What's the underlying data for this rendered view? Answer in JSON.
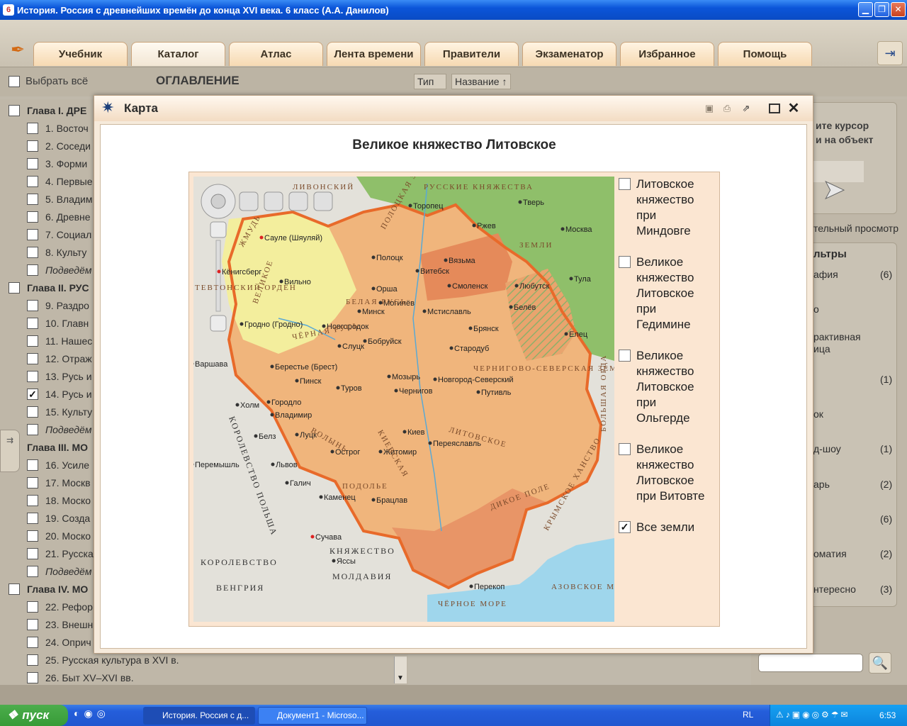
{
  "window": {
    "title": "История. Россия с древнейших времён до конца XVI века. 6 класс (А.А. Данилов)"
  },
  "nav": {
    "tabs": [
      "Учебник",
      "Каталог",
      "Атлас",
      "Лента времени",
      "Правители",
      "Экзаменатор",
      "Избранное",
      "Помощь"
    ],
    "active": "Каталог"
  },
  "toc_toolbar": {
    "select_all": "Выбрать всё",
    "title": "ОГЛАВЛЕНИЕ",
    "sort_type": "Тип",
    "sort_name": "Название"
  },
  "toc": [
    {
      "label": "Глава I. ДРЕ",
      "kind": "chapter",
      "checked": false
    },
    {
      "label": "1. Восточ",
      "kind": "item",
      "checked": false
    },
    {
      "label": "2. Соседи",
      "kind": "item",
      "checked": false
    },
    {
      "label": "3. Форми",
      "kind": "item",
      "checked": false
    },
    {
      "label": "4. Первые",
      "kind": "item",
      "checked": false
    },
    {
      "label": "5. Владим",
      "kind": "item",
      "checked": false
    },
    {
      "label": "6. Древне",
      "kind": "item",
      "checked": false
    },
    {
      "label": "7. Социал",
      "kind": "item",
      "checked": false
    },
    {
      "label": "8. Культу",
      "kind": "item",
      "checked": false
    },
    {
      "label": "Подведём",
      "kind": "summary",
      "checked": false
    },
    {
      "label": "Глава II. РУС",
      "kind": "chapter",
      "checked": false
    },
    {
      "label": "9. Раздро",
      "kind": "item",
      "checked": false
    },
    {
      "label": "10. Главн",
      "kind": "item",
      "checked": false
    },
    {
      "label": "11. Нашес",
      "kind": "item",
      "checked": false
    },
    {
      "label": "12. Отраж",
      "kind": "item",
      "checked": false
    },
    {
      "label": "13. Русь и",
      "kind": "item",
      "checked": false
    },
    {
      "label": "14. Русь и",
      "kind": "item",
      "checked": true
    },
    {
      "label": "15. Культу",
      "kind": "item",
      "checked": false
    },
    {
      "label": "Подведём",
      "kind": "summary",
      "checked": false
    },
    {
      "label": "Глава III. МО",
      "kind": "chapter",
      "checked": false
    },
    {
      "label": "16. Усиле",
      "kind": "item",
      "checked": false
    },
    {
      "label": "17. Москв",
      "kind": "item",
      "checked": false
    },
    {
      "label": "18. Моско",
      "kind": "item",
      "checked": false
    },
    {
      "label": "19. Созда",
      "kind": "item",
      "checked": false
    },
    {
      "label": "20. Моско",
      "kind": "item",
      "checked": false
    },
    {
      "label": "21. Русска",
      "kind": "item",
      "checked": false
    },
    {
      "label": "Подведём",
      "kind": "summary",
      "checked": false
    },
    {
      "label": "Глава IV. МО",
      "kind": "chapter",
      "checked": false
    },
    {
      "label": "22. Рефор",
      "kind": "item",
      "checked": false
    },
    {
      "label": "23. Внешн",
      "kind": "item",
      "checked": false
    },
    {
      "label": "24. Оприч",
      "kind": "item",
      "checked": false
    },
    {
      "label": "25. Русская культура в XVI в.",
      "kind": "item",
      "checked": false
    },
    {
      "label": "26. Быт XV–XVI вв.",
      "kind": "item",
      "checked": false
    }
  ],
  "right_panel": {
    "hint_line1": "ите курсор",
    "hint_line2": "и на объект",
    "preview_label": "тельный просмотр",
    "filters_title": "льтры",
    "filters": [
      {
        "label": "афия",
        "count": "(6)"
      },
      {
        "label": "о",
        "count": ""
      },
      {
        "label": "рактивная",
        "count": ""
      },
      {
        "label": "ица",
        "count": ""
      },
      {
        "label": "",
        "count": "(1)"
      },
      {
        "label": "ок",
        "count": ""
      },
      {
        "label": "д-шоу",
        "count": "(1)"
      },
      {
        "label": "арь",
        "count": "(2)"
      },
      {
        "label": "",
        "count": "(6)"
      },
      {
        "label": "оматия",
        "count": "(2)"
      },
      {
        "label": "нтересно",
        "count": "(3)"
      }
    ]
  },
  "modal": {
    "title": "Карта",
    "map_title": "Великое княжество Литовское",
    "layers": [
      {
        "lines": [
          "Литовское",
          "княжество",
          "при",
          "Миндовге"
        ],
        "checked": false
      },
      {
        "lines": [
          "Великое",
          "княжество",
          "Литовское",
          "при",
          "Гедимине"
        ],
        "checked": false
      },
      {
        "lines": [
          "Великое",
          "княжество",
          "Литовское",
          "при",
          "Ольгерде"
        ],
        "checked": false
      },
      {
        "lines": [
          "Великое",
          "княжество",
          "Литовское",
          "при Витовте"
        ],
        "checked": false
      },
      {
        "lines": [
          "Все земли"
        ],
        "checked": true
      }
    ],
    "map_labels": {
      "cities": [
        "Торопец",
        "Тверь",
        "Ржев",
        "Москва",
        "Вязьма",
        "Смоленск",
        "Витебск",
        "Полоцк",
        "Орша",
        "Могилёв",
        "Мстиславль",
        "Любутск",
        "Тула",
        "Белёв",
        "Брянск",
        "Елец",
        "Стародуб",
        "Минск",
        "Новгородок",
        "Слуцк",
        "Бобруйск",
        "Вильно",
        "Сауле (Шяуляй)",
        "Кёнигсберг",
        "Гродно (Гродно)",
        "Берестье (Брест)",
        "Пинск",
        "Туров",
        "Мозырь",
        "Чернигов",
        "Новгород-Северский",
        "Путивль",
        "Варшава",
        "Холм",
        "Городло",
        "Владимир",
        "Луцк",
        "Белз",
        "Острог",
        "Житомир",
        "Киев",
        "Переяславль",
        "Перемышль",
        "Львов",
        "Галич",
        "Каменец",
        "Брацлав",
        "Сучава",
        "Яссы",
        "Перекоп"
      ],
      "regions": [
        "ЛИВОНСКИЙ",
        "РУССКИЕ КНЯЖЕСТВА",
        "ЗЕМЛИ",
        "ЖМУДЬ",
        "ВЕЛИКОЕ",
        "ПОЛОЦКАЯ ЗЕМЛЯ",
        "БЕЛАЯ РУСЬ",
        "ЧЁРНАЯ РУСЬ",
        "ЛИТОВСКОЕ",
        "ЧЕРНИГОВО-СЕВЕРСКАЯ ЗЕМЛЯ",
        "ВОЛЫНЬ",
        "КИЕВСКАЯ",
        "ПОДОЛЬЕ",
        "КОРОЛЕВСТВО ПОЛЬША",
        "КОРОЛЕВСТВО",
        "ВЕНГРИЯ",
        "КНЯЖЕСТВО",
        "МОЛДАВИЯ",
        "КРЫМСКОЕ ХАНСТВО",
        "АЗОВСКОЕ МОРЕ",
        "ЧЁРНОЕ МОРЕ",
        "БОЛЬШАЯ ОРДА",
        "ДИКОЕ ПОЛЕ",
        "ТЕВТОНСКИЙ ОРДЕН"
      ]
    }
  },
  "taskbar": {
    "start": "пуск",
    "items": [
      "История. Россия с д...",
      "Документ1 - Microso..."
    ],
    "lang": "RL",
    "clock": "6:53"
  },
  "colors": {
    "title_bar": "#0b55d9",
    "tab_fill": "#f6d9b2",
    "modal_bg": "#f6eadb",
    "lithuania": "#f0b57c",
    "russia": "#8fbf6a",
    "sea": "#9fd6ec",
    "border": "#e86a2a"
  }
}
